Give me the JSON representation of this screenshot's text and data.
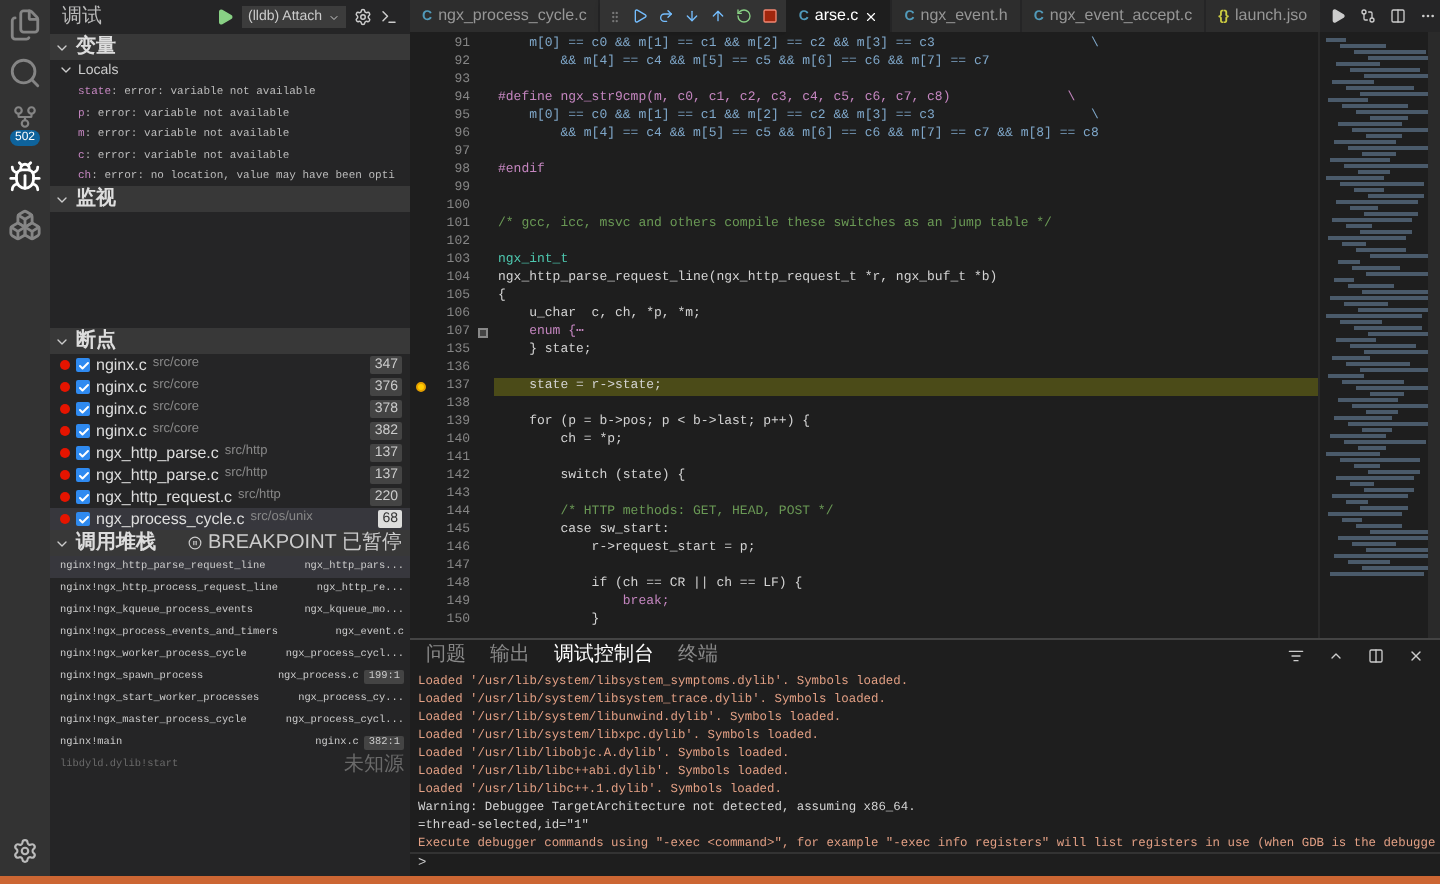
{
  "activity_bar": {
    "items": [
      {
        "kind": "files",
        "selected": false
      },
      {
        "kind": "search",
        "selected": false
      },
      {
        "kind": "source-control",
        "selected": false,
        "badge": "502"
      },
      {
        "kind": "debug",
        "selected": true
      },
      {
        "kind": "extensions",
        "selected": false
      }
    ]
  },
  "sidebar": {
    "title": "调试",
    "config": "(lldb) Attach",
    "variables": {
      "title": "变量",
      "expanded": true,
      "scope": {
        "title": "Locals",
        "expanded": true,
        "items": [
          {
            "name": "state",
            "value": ": error: variable not available"
          },
          {
            "name": "p",
            "value": ": error: variable not available"
          },
          {
            "name": "m",
            "value": ": error: variable not available"
          },
          {
            "name": "c",
            "value": ": error: variable not available"
          },
          {
            "name": "ch",
            "value": ": error: no location, value may have been opti"
          }
        ]
      }
    },
    "watch": {
      "title": "监视",
      "expanded": true
    },
    "breakpoints": {
      "title": "断点",
      "expanded": true,
      "items": [
        {
          "file": "nginx.c",
          "path": "src/core",
          "line": "347",
          "checked": true,
          "selected": false
        },
        {
          "file": "nginx.c",
          "path": "src/core",
          "line": "376",
          "checked": true,
          "selected": false
        },
        {
          "file": "nginx.c",
          "path": "src/core",
          "line": "378",
          "checked": true,
          "selected": false
        },
        {
          "file": "nginx.c",
          "path": "src/core",
          "line": "382",
          "checked": true,
          "selected": false
        },
        {
          "file": "ngx_http_parse.c",
          "path": "src/http",
          "line": "137",
          "checked": true,
          "selected": false
        },
        {
          "file": "ngx_http_parse.c",
          "path": "src/http",
          "line": "137",
          "checked": true,
          "selected": false
        },
        {
          "file": "ngx_http_request.c",
          "path": "src/http",
          "line": "220",
          "checked": true,
          "selected": false
        },
        {
          "file": "ngx_process_cycle.c",
          "path": "src/os/unix",
          "line": "68",
          "checked": true,
          "selected": true
        }
      ]
    },
    "call_stack": {
      "title": "调用堆栈",
      "expanded": true,
      "status": "BREAKPOINT 已暂停",
      "frames": [
        {
          "function": "nginx!ngx_http_parse_request_line",
          "file": "ngx_http_pars...",
          "selected": true,
          "dimmed": false
        },
        {
          "function": "nginx!ngx_http_process_request_line",
          "file": "ngx_http_re...",
          "selected": false,
          "dimmed": false
        },
        {
          "function": "nginx!ngx_kqueue_process_events",
          "file": "ngx_kqueue_mo...",
          "selected": false,
          "dimmed": false
        },
        {
          "function": "nginx!ngx_process_events_and_timers",
          "file": "ngx_event.c",
          "selected": false,
          "dimmed": false
        },
        {
          "function": "nginx!ngx_worker_process_cycle",
          "file": "ngx_process_cycl...",
          "selected": false,
          "dimmed": false
        },
        {
          "function": "nginx!ngx_spawn_process",
          "file": "ngx_process.c",
          "position": "199:1",
          "selected": false,
          "dimmed": false
        },
        {
          "function": "nginx!ngx_start_worker_processes",
          "file": "ngx_process_cy...",
          "selected": false,
          "dimmed": false
        },
        {
          "function": "nginx!ngx_master_process_cycle",
          "file": "ngx_process_cycl...",
          "selected": false,
          "dimmed": false
        },
        {
          "function": "nginx!main",
          "file": "nginx.c",
          "position": "382:1",
          "selected": false,
          "dimmed": false
        },
        {
          "function": "libdyld.dylib!start",
          "file": "未知源",
          "selected": false,
          "dimmed": true
        }
      ]
    }
  },
  "editor": {
    "tabs": [
      {
        "label": "ngx_process_cycle.c",
        "icon": "C",
        "kind": "c",
        "selected": false
      },
      {
        "label": "arse.c",
        "icon": "C",
        "kind": "c",
        "selected": true
      },
      {
        "label": "ngx_event.h",
        "icon": "C",
        "kind": "c",
        "selected": false
      },
      {
        "label": "ngx_event_accept.c",
        "icon": "C",
        "kind": "c",
        "selected": false
      },
      {
        "label": "launch.jso",
        "icon": "{}",
        "kind": "json",
        "selected": false
      }
    ],
    "lines": [
      {
        "number": "91",
        "text": "    m[0] == c0 && m[1] == c1 && m[2] == c2 && m[3] == c3                    \\",
        "kind": "macro",
        "current": false,
        "folded": false
      },
      {
        "number": "92",
        "text": "        && m[4] == c4 && m[5] == c5 && m[6] == c6 && m[7] == c7",
        "kind": "macro",
        "current": false,
        "folded": false
      },
      {
        "number": "93",
        "current": false,
        "folded": false
      },
      {
        "number": "94",
        "text": "#define ngx_str9cmp(m, c0, c1, c2, c3, c4, c5, c6, c7, c8)               \\",
        "kind": "preproc",
        "current": false,
        "folded": false
      },
      {
        "number": "95",
        "text": "    m[0] == c0 && m[1] == c1 && m[2] == c2 && m[3] == c3                    \\",
        "kind": "macro",
        "current": false,
        "folded": false
      },
      {
        "number": "96",
        "text": "        && m[4] == c4 && m[5] == c5 && m[6] == c6 && m[7] == c7 && m[8] == c8",
        "kind": "macro",
        "current": false,
        "folded": false
      },
      {
        "number": "97",
        "current": false,
        "folded": false
      },
      {
        "number": "98",
        "text": "#endif",
        "kind": "preproc",
        "current": false,
        "folded": false
      },
      {
        "number": "99",
        "current": false,
        "folded": false
      },
      {
        "number": "100",
        "current": false,
        "folded": false
      },
      {
        "number": "101",
        "text": "/* gcc, icc, msvc and others compile these switches as an jump table */",
        "kind": "comment",
        "current": false,
        "folded": false
      },
      {
        "number": "102",
        "current": false,
        "folded": false
      },
      {
        "number": "103",
        "text": "ngx_int_t",
        "kind": "type",
        "current": false,
        "folded": false
      },
      {
        "number": "104",
        "text": "ngx_http_parse_request_line(ngx_http_request_t *r, ngx_buf_t *b)",
        "kind": "code",
        "current": false,
        "folded": false
      },
      {
        "number": "105",
        "text": "{",
        "kind": "code",
        "current": false,
        "folded": false
      },
      {
        "number": "106",
        "text": "    u_char  c, ch, *p, *m;",
        "kind": "code",
        "current": false,
        "folded": false
      },
      {
        "number": "107",
        "text": "    enum {⋯",
        "kind": "keyword",
        "current": false,
        "folded": true
      },
      {
        "number": "135",
        "text": "    } state;",
        "kind": "code",
        "current": false,
        "folded": false
      },
      {
        "number": "136",
        "current": false,
        "folded": false
      },
      {
        "number": "137",
        "text": "    state = r->state;",
        "kind": "code",
        "current": true,
        "folded": false
      },
      {
        "number": "138",
        "current": false,
        "folded": false
      },
      {
        "number": "139",
        "text": "    for (p = b->pos; p < b->last; p++) {",
        "kind": "code",
        "current": false,
        "folded": false
      },
      {
        "number": "140",
        "text": "        ch = *p;",
        "kind": "code",
        "current": false,
        "folded": false
      },
      {
        "number": "141",
        "current": false,
        "folded": false
      },
      {
        "number": "142",
        "text": "        switch (state) {",
        "kind": "code",
        "current": false,
        "folded": false
      },
      {
        "number": "143",
        "current": false,
        "folded": false
      },
      {
        "number": "144",
        "text": "        /* HTTP methods: GET, HEAD, POST */",
        "kind": "comment",
        "current": false,
        "folded": false
      },
      {
        "number": "145",
        "text": "        case sw_start:",
        "kind": "code",
        "current": false,
        "folded": false
      },
      {
        "number": "146",
        "text": "            r->request_start = p;",
        "kind": "code",
        "current": false,
        "folded": false
      },
      {
        "number": "147",
        "current": false,
        "folded": false
      },
      {
        "number": "148",
        "text": "            if (ch == CR || ch == LF) {",
        "kind": "code",
        "current": false,
        "folded": false
      },
      {
        "number": "149",
        "text": "                break;",
        "kind": "keyword",
        "current": false,
        "folded": false
      },
      {
        "number": "150",
        "text": "            }",
        "kind": "code",
        "current": false,
        "folded": false
      }
    ]
  },
  "panel": {
    "tabs": [
      {
        "label": "问题",
        "selected": false
      },
      {
        "label": "输出",
        "selected": false
      },
      {
        "label": "调试控制台",
        "selected": true
      },
      {
        "label": "终端",
        "selected": false
      }
    ],
    "console": [
      {
        "text": "Loaded '/usr/lib/system/libsystem_symptoms.dylib'. Symbols loaded.",
        "kind": "info"
      },
      {
        "text": "Loaded '/usr/lib/system/libsystem_trace.dylib'. Symbols loaded.",
        "kind": "info"
      },
      {
        "text": "Loaded '/usr/lib/system/libunwind.dylib'. Symbols loaded.",
        "kind": "info"
      },
      {
        "text": "Loaded '/usr/lib/system/libxpc.dylib'. Symbols loaded.",
        "kind": "info"
      },
      {
        "text": "Loaded '/usr/lib/libobjc.A.dylib'. Symbols loaded.",
        "kind": "info"
      },
      {
        "text": "Loaded '/usr/lib/libc++abi.dylib'. Symbols loaded.",
        "kind": "info"
      },
      {
        "text": "Loaded '/usr/lib/libc++.1.dylib'. Symbols loaded.",
        "kind": "info"
      },
      {
        "text": "Warning: Debuggee TargetArchitecture not detected, assuming x86_64.",
        "kind": "plain"
      },
      {
        "text": "=thread-selected,id=\"1\"",
        "kind": "plain"
      },
      {
        "text": "Execute debugger commands using \"-exec <command>\", for example \"-exec info registers\" will list registers in use (when GDB is the debugge",
        "kind": "info"
      }
    ],
    "prompt": ">"
  }
}
